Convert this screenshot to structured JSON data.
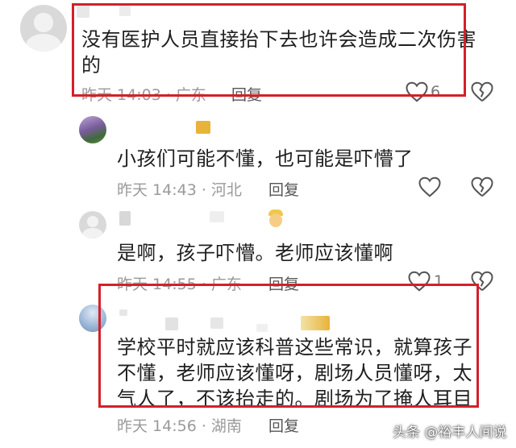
{
  "comments": [
    {
      "text_line1": "没有医护人员直接抬下去也许会造成二次伤害",
      "text_line2": "的",
      "meta": "昨天 14:03 · 广东",
      "reply_label": "回复",
      "like_count": "6"
    },
    {
      "text": "小孩们可能不懂，也可能是吓懵了",
      "meta": "昨天 14:43 · 河北",
      "reply_label": "回复",
      "like_count": ""
    },
    {
      "text": "是啊，孩子吓懵。老师应该懂啊",
      "meta": "昨天 14:55 · 广东",
      "reply_label": "回复",
      "like_count": "1"
    },
    {
      "text_line1": "学校平时就应该科普这些常识，就算孩子",
      "text_line2": "不懂，老师应该懂呀，剧场人员懂呀，太",
      "text_line3": "气人了，不该抬走的。剧场为了掩人耳目",
      "meta": "昨天 14:56 · 湖南",
      "reply_label": "回复",
      "like_count": ""
    }
  ],
  "watermark": "头条 @裕丰人间说",
  "colors": {
    "highlight_box": "#d3202a",
    "meta_gray": "#9a9a9a"
  }
}
